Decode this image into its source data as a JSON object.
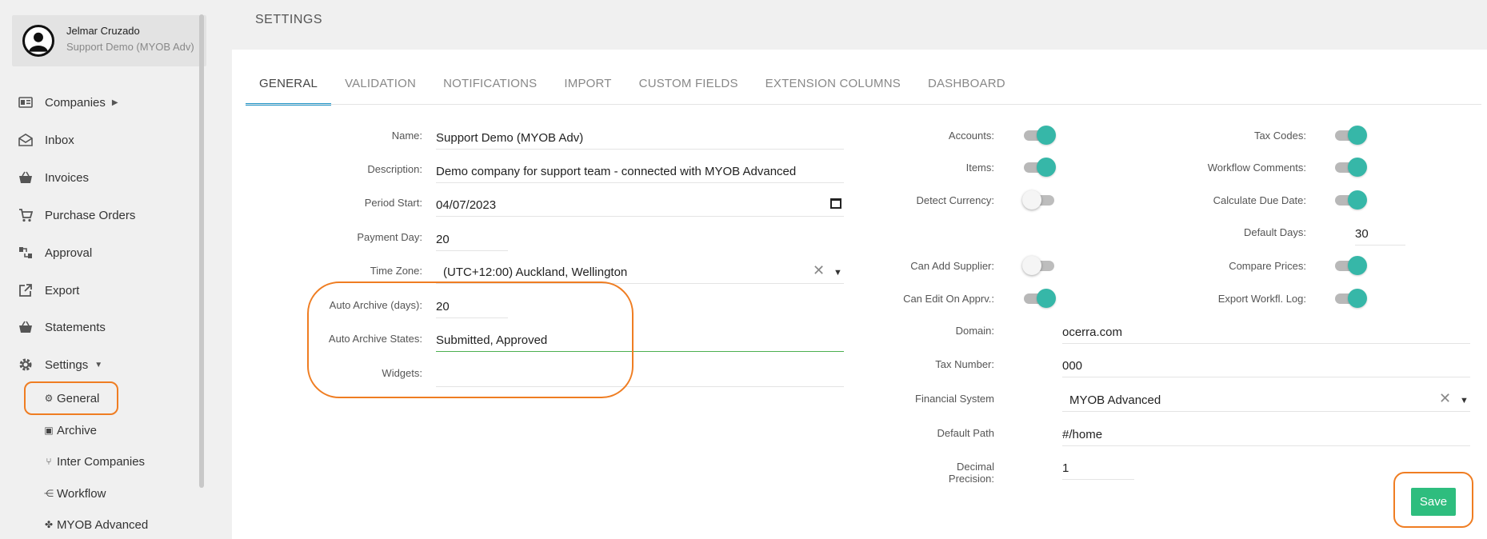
{
  "user": {
    "name": "Jelmar Cruzado",
    "company": "Support Demo (MYOB Adv)"
  },
  "nav": {
    "companies": "Companies",
    "inbox": "Inbox",
    "invoices": "Invoices",
    "purchase_orders": "Purchase Orders",
    "approval": "Approval",
    "export": "Export",
    "statements": "Statements",
    "settings": "Settings"
  },
  "settings_sub": {
    "general": "General",
    "archive": "Archive",
    "inter_companies": "Inter Companies",
    "workflow": "Workflow",
    "myob_advanced": "MYOB Advanced"
  },
  "page_title": "SETTINGS",
  "tabs": [
    "GENERAL",
    "VALIDATION",
    "NOTIFICATIONS",
    "IMPORT",
    "CUSTOM FIELDS",
    "EXTENSION COLUMNS",
    "DASHBOARD"
  ],
  "form": {
    "name_label": "Name:",
    "name_value": "Support Demo (MYOB Adv)",
    "description_label": "Description:",
    "description_value": "Demo company for support team - connected with MYOB Advanced",
    "period_start_label": "Period Start:",
    "period_start_value": "04/07/2023",
    "payment_day_label": "Payment Day:",
    "payment_day_value": "20",
    "time_zone_label": "Time Zone:",
    "time_zone_value": "(UTC+12:00) Auckland, Wellington",
    "auto_archive_days_label": "Auto Archive (days):",
    "auto_archive_days_value": "20",
    "auto_archive_states_label": "Auto Archive States:",
    "auto_archive_states_value": "Submitted, Approved",
    "widgets_label": "Widgets:",
    "widgets_value": ""
  },
  "toggles_left": [
    {
      "label": "Accounts:",
      "on": true
    },
    {
      "label": "Items:",
      "on": true
    },
    {
      "label": "Detect Currency:",
      "on": false
    },
    {
      "label": "Can Add Supplier:",
      "on": false
    },
    {
      "label": "Can Edit On Apprv.:",
      "on": true
    }
  ],
  "toggles_right": [
    {
      "label": "Tax Codes:",
      "on": true
    },
    {
      "label": "Workflow Comments:",
      "on": true
    },
    {
      "label": "Calculate Due Date:",
      "on": true
    },
    {
      "label": "Compare Prices:",
      "on": true
    },
    {
      "label": "Export Workfl. Log:",
      "on": true
    }
  ],
  "default_days": {
    "label": "Default Days:",
    "value": "30"
  },
  "right_form": {
    "domain_label": "Domain:",
    "domain_value": "ocerra.com",
    "tax_number_label": "Tax Number:",
    "tax_number_value": "000",
    "financial_system_label": "Financial System",
    "financial_system_value": "MYOB Advanced",
    "default_path_label": "Default Path",
    "default_path_value": "#/home",
    "decimal_precision_label": "Decimal Precision:",
    "decimal_precision_value": "1"
  },
  "save_label": "Save",
  "colors": {
    "accent_tab": "#2196c9",
    "toggle_on": "#36b7a8",
    "save": "#2ebd7e",
    "annotation": "#ef7d22"
  }
}
